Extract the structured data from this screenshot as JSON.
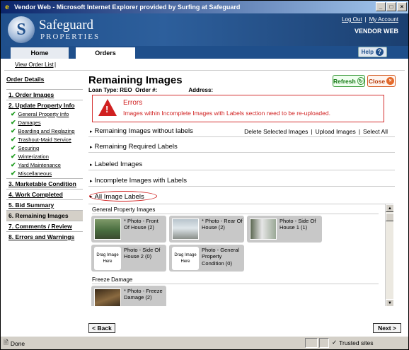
{
  "window": {
    "title": "Vendor Web - Microsoft Internet Explorer provided by Surfing at Safeguard"
  },
  "brand": {
    "logo_letter": "S",
    "name": "Safeguard",
    "sub": "PROPERTIES"
  },
  "header": {
    "logout": "Log Out",
    "sep": "|",
    "account": "My Account",
    "app": "VENDOR WEB"
  },
  "tabs": {
    "home": "Home",
    "orders": "Orders",
    "help": "Help"
  },
  "breadcrumb": {
    "view_order_list": "View Order List",
    "sep": "|"
  },
  "sidebar": {
    "order_details": "Order Details",
    "items": [
      {
        "label": "1. Order Images"
      },
      {
        "label": "2. Update Property Info"
      },
      {
        "label": "3. Marketable Condition"
      },
      {
        "label": "4. Work Completed"
      },
      {
        "label": "5. Bid Summary"
      },
      {
        "label": "6. Remaining Images"
      },
      {
        "label": "7. Comments / Review"
      },
      {
        "label": "8. Errors and Warnings"
      }
    ],
    "subs": [
      "General Property Info",
      "Damages",
      "Boarding and Reglazing",
      "Trashout-Maid Service",
      "Securing",
      "Winterization",
      "Yard Maintenance",
      "Miscellaneous"
    ]
  },
  "page": {
    "title": "Remaining Images",
    "loan_type": "Loan Type: REO",
    "order_no": "Order #:",
    "address": "Address:",
    "refresh": "Refresh",
    "close": "Close"
  },
  "error": {
    "title": "Errors",
    "message": "Images within Incomplete Images with Labels section need to be re-uploaded."
  },
  "sections": {
    "s1": "Remaining Images without labels",
    "s2": "Remaining Required Labels",
    "s3": "Labeled Images",
    "s4": "Incomplete Images with Labels",
    "s5": "All Image Labels",
    "links": {
      "delete": "Delete Selected Images",
      "upload": "Upload Images",
      "select": "Select All",
      "sep": "|"
    }
  },
  "gallery": {
    "g1": "General Property Images",
    "g2": "Freeze Damage",
    "drag": "Drag Image Here",
    "cards": [
      "* Photo - Front Of House (2)",
      "* Photo - Rear Of House (2)",
      "Photo - Side Of House 1 (1)",
      "Photo - Side Of House 2 (0)",
      "Photo - General Property Condition (0)",
      "* Photo - Freeze Damage (2)"
    ]
  },
  "nav": {
    "back": "< Back",
    "next": "Next >"
  },
  "status": {
    "done": "Done",
    "zone": "Trusted sites"
  }
}
